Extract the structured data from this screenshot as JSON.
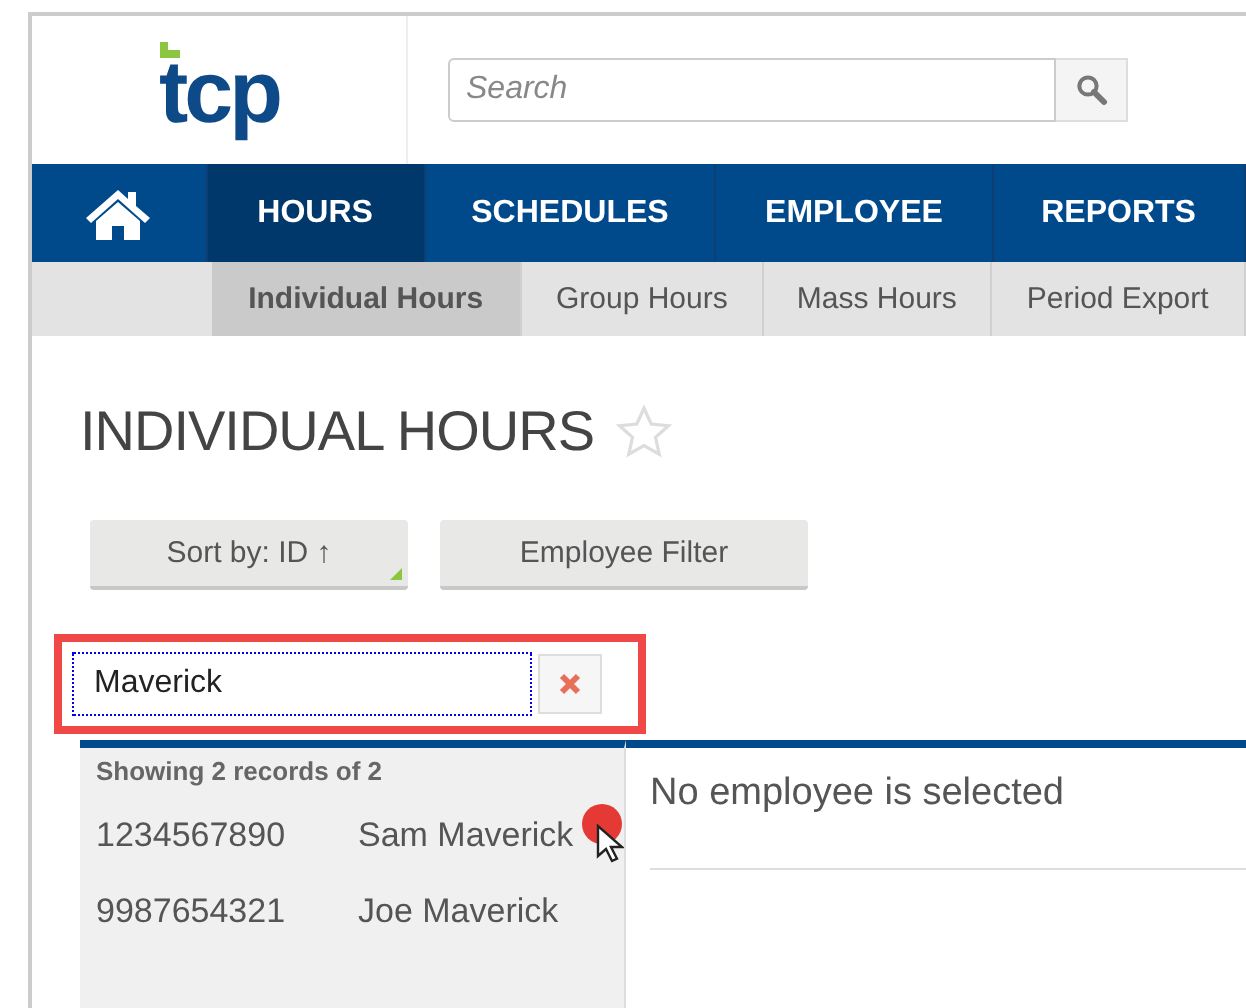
{
  "logo": {
    "text": "tcp"
  },
  "search": {
    "placeholder": "Search"
  },
  "nav": [
    {
      "label": "HOURS",
      "selected": true
    },
    {
      "label": "SCHEDULES",
      "selected": false
    },
    {
      "label": "EMPLOYEE",
      "selected": false
    },
    {
      "label": "REPORTS",
      "selected": false
    }
  ],
  "subnav": [
    {
      "label": "Individual Hours",
      "selected": true
    },
    {
      "label": "Group Hours",
      "selected": false
    },
    {
      "label": "Mass Hours",
      "selected": false
    },
    {
      "label": "Period Export",
      "selected": false
    }
  ],
  "page_title": "INDIVIDUAL HOURS",
  "buttons": [
    "Sort by: ID ↑",
    "Employee Filter"
  ],
  "filter": {
    "value": "Maverick"
  },
  "records": {
    "summary": "Showing 2 records of 2",
    "rows": [
      {
        "id": "1234567890",
        "name": "Sam Maverick",
        "selected": false
      },
      {
        "id": "9987654321",
        "name": "Joe Maverick",
        "selected": false
      }
    ]
  },
  "detail": {
    "message": "No employee is selected"
  }
}
